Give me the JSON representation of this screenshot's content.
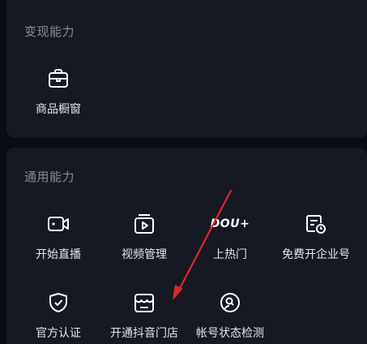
{
  "sections": [
    {
      "title": "变现能力",
      "items": [
        {
          "label": "商品橱窗",
          "icon": "storefront-briefcase-icon"
        }
      ]
    },
    {
      "title": "通用能力",
      "items": [
        {
          "label": "开始直播",
          "icon": "video-camera-icon"
        },
        {
          "label": "视频管理",
          "icon": "video-folder-icon"
        },
        {
          "label": "上热门",
          "icon": "dou-plus-icon",
          "icon_text": "DOU+"
        },
        {
          "label": "免费开企业号",
          "icon": "enterprise-account-icon"
        },
        {
          "label": "官方认证",
          "icon": "shield-check-icon"
        },
        {
          "label": "开通抖音门店",
          "icon": "shop-icon"
        },
        {
          "label": "帐号状态检测",
          "icon": "account-status-icon"
        }
      ]
    }
  ],
  "colors": {
    "background": "#0b0b12",
    "card": "#161823",
    "section_title": "#8a8b93",
    "label": "#e6e6ea",
    "annotation_arrow": "#e0262b"
  }
}
